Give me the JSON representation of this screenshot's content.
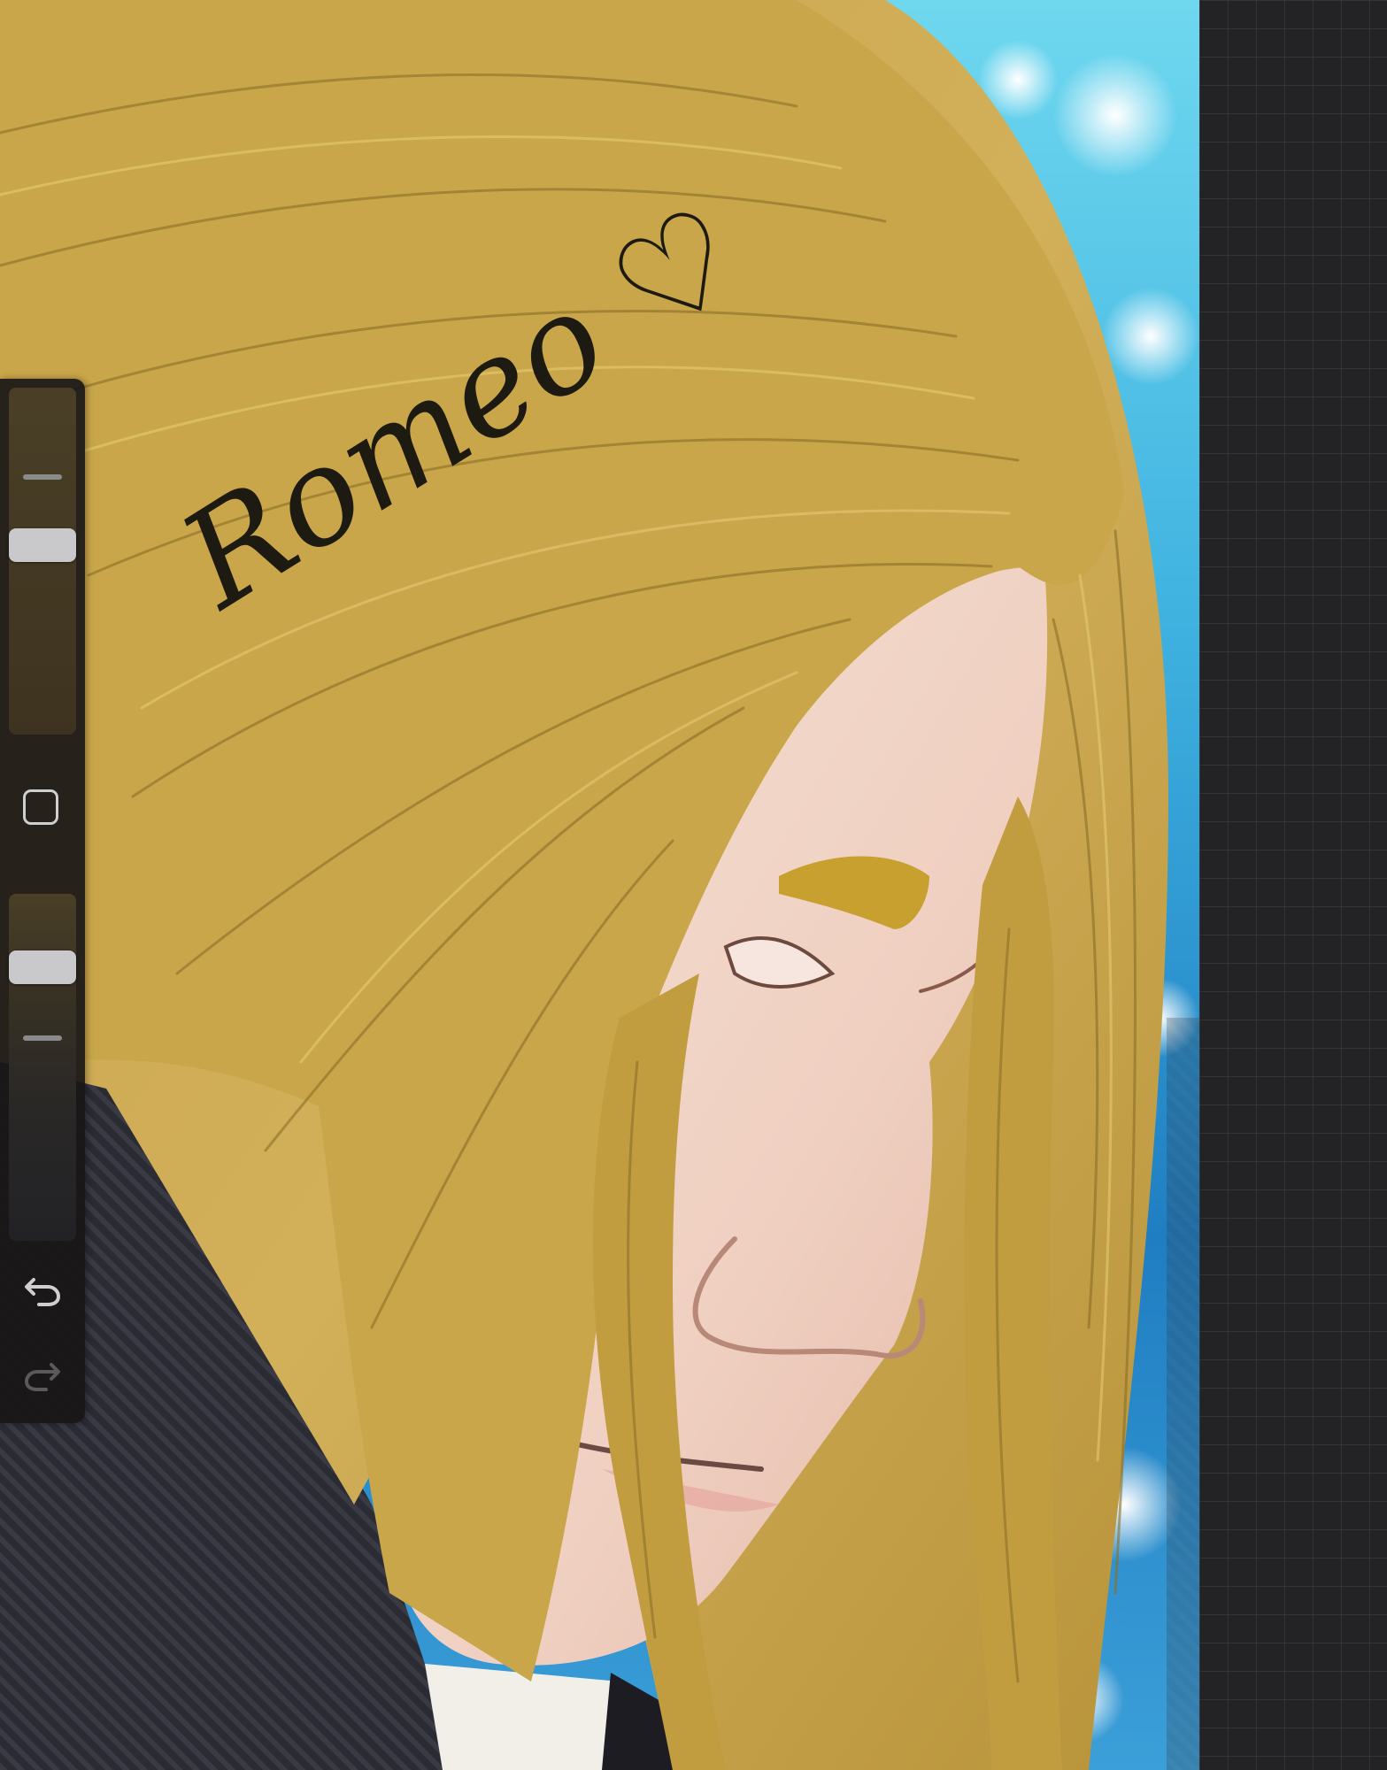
{
  "canvas": {
    "artwork_signature": "Romeo ♡",
    "colors": {
      "hair": "#c9a64a",
      "hair_dark": "#8a6f28",
      "skin": "#f0d4c6",
      "background_light": "#5fd0ea",
      "background_dark": "#1f7ec2",
      "clothing": "#2a2a33"
    }
  },
  "sidebar": {
    "brush_size_level": 0.55,
    "brush_opacity_level": 0.82,
    "icons": {
      "modify": "square-modify-icon",
      "undo": "undo-arrow-icon",
      "redo": "redo-arrow-icon"
    },
    "colors": {
      "panel": "#181616",
      "thumb": "#c9c9cc",
      "icon": "#cfcfcf",
      "icon_disabled": "#5a5a5c"
    }
  },
  "workspace": {
    "background": "#232325"
  }
}
